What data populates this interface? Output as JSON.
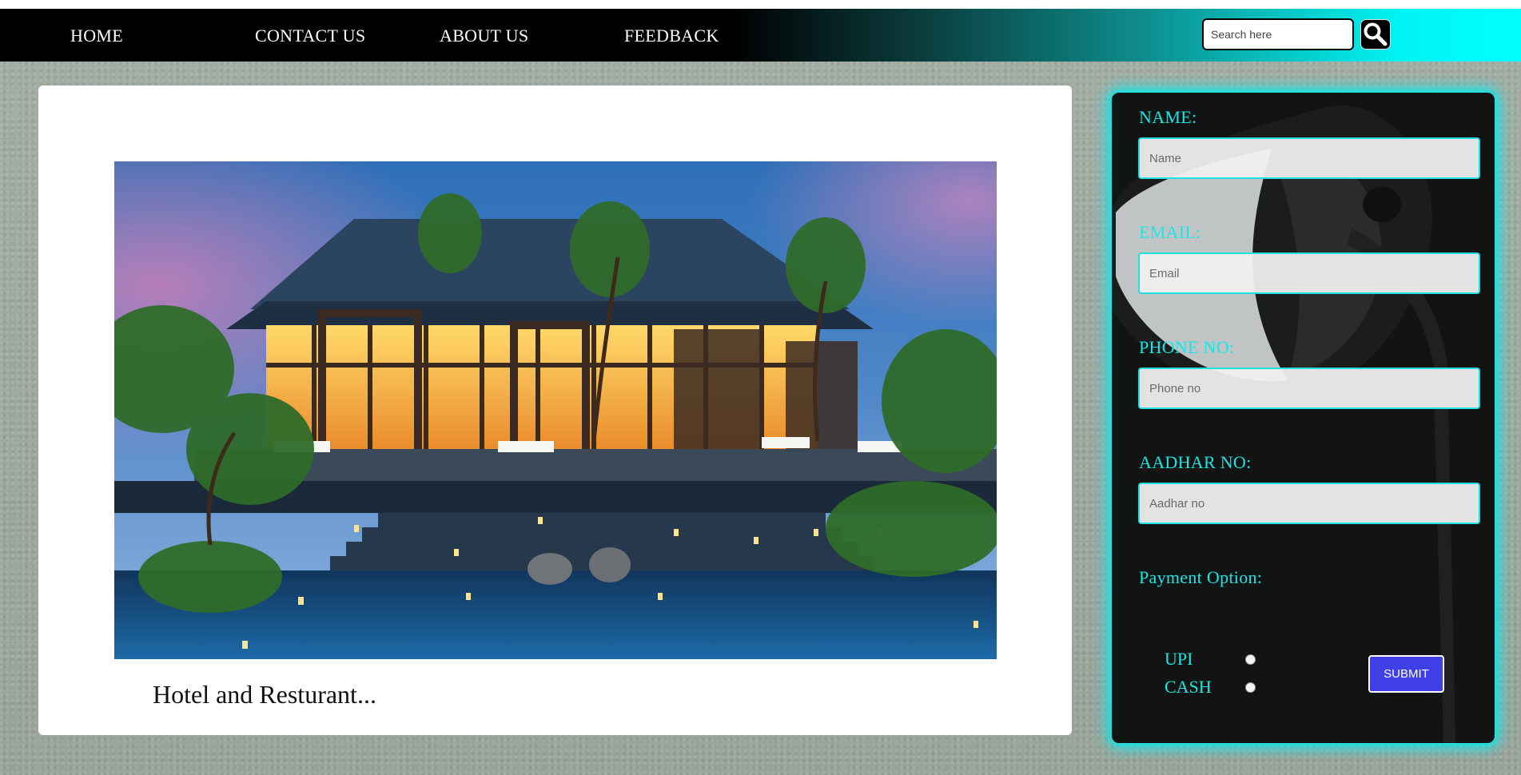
{
  "nav": {
    "links": [
      "HOME",
      "CONTACT US",
      "ABOUT US",
      "FEEDBACK"
    ],
    "search_placeholder": "Search here"
  },
  "main": {
    "image_icon": "hotel-restaurant-photo",
    "caption": "Hotel and Resturant..."
  },
  "form": {
    "name_label": "NAME:",
    "name_placeholder": "Name",
    "email_label": "EMAIL:",
    "email_placeholder": "Email",
    "phone_label": "PHONE NO:",
    "phone_placeholder": "Phone no",
    "aadhar_label": "AADHAR NO:",
    "aadhar_placeholder": "Aadhar no",
    "payment_label": "Payment Option:",
    "payment_options": [
      "UPI",
      "CASH"
    ],
    "submit_label": "SUBMIT"
  },
  "colors": {
    "accent_cyan": "#19e6e6",
    "submit_blue": "#3f3fe6",
    "panel_bg": "#121313"
  }
}
